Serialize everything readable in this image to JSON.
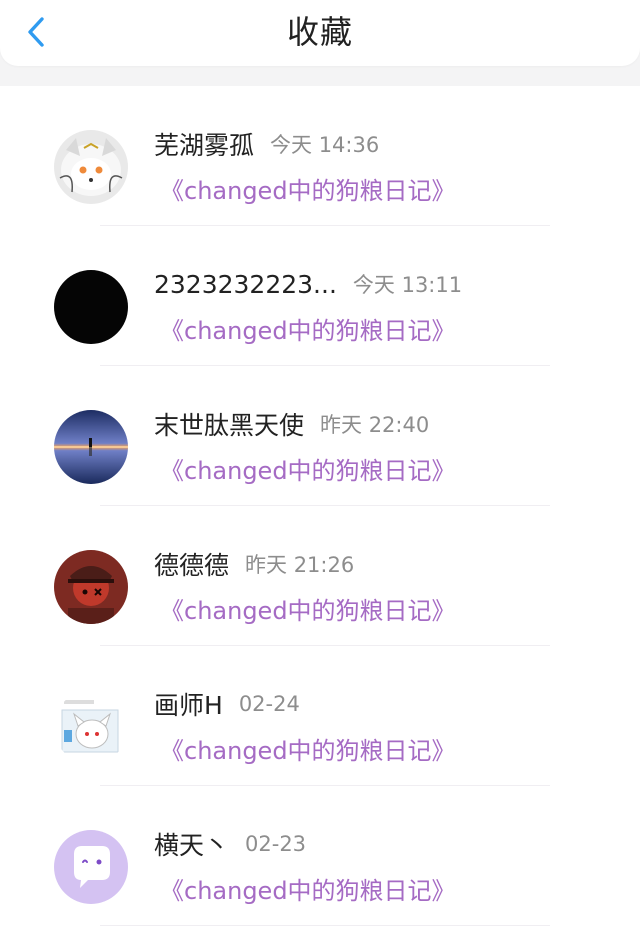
{
  "header": {
    "title": "收藏",
    "back_icon": "chevron-left-icon",
    "accent_color": "#2f9bf0"
  },
  "items": [
    {
      "name": "芜湖雾孤",
      "time": "今天 14:36",
      "work": "《changed中的狗粮日记》",
      "avatar_icon": "white-fox-avatar"
    },
    {
      "name": "2323232223...",
      "time": "今天 13:11",
      "work": "《changed中的狗粮日记》",
      "avatar_icon": "black-circle-avatar"
    },
    {
      "name": "末世肽黑天使",
      "time": "昨天 22:40",
      "work": "《changed中的狗粮日记》",
      "avatar_icon": "sunset-reflection-avatar"
    },
    {
      "name": "德德德",
      "time": "昨天 21:26",
      "work": "《changed中的狗粮日记》",
      "avatar_icon": "red-uniform-character-avatar"
    },
    {
      "name": "画师H",
      "time": "02-24",
      "work": "《changed中的狗粮日记》",
      "avatar_icon": "white-character-drawing-avatar"
    },
    {
      "name": "横天丶",
      "time": "02-23",
      "work": "《changed中的狗粮日记》",
      "avatar_icon": "purple-chat-bubble-avatar"
    }
  ],
  "colors": {
    "work_link": "#a56bc4",
    "name_text": "#222222",
    "time_text": "#8d8d8d",
    "background": "#f4f4f5"
  }
}
